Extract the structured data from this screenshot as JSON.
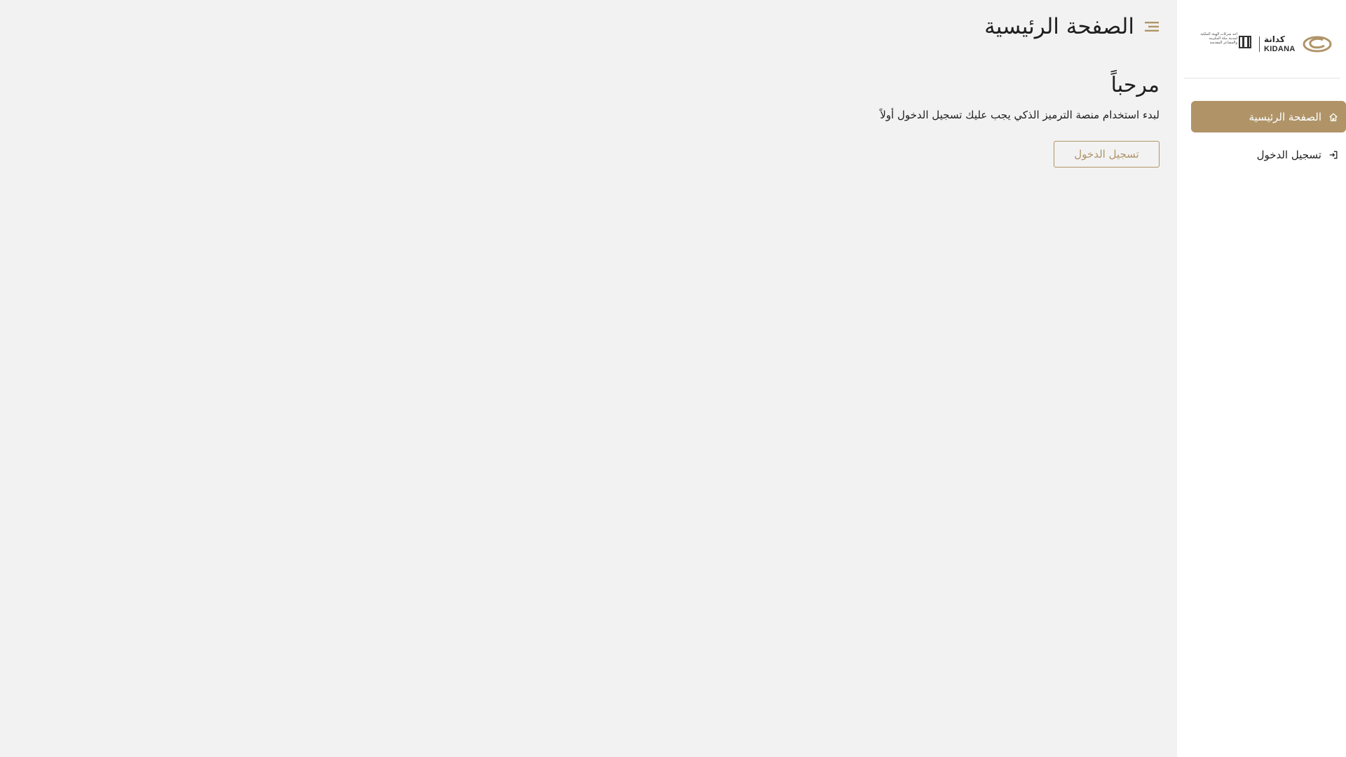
{
  "brand": {
    "accent_color": "#b09468",
    "logo": {
      "arabic_wordmark": "كدانة",
      "latin_wordmark": "KIDANA",
      "partner_text": "أحد شركات الهيئة الملكية لمدينة مكة المكرمة والمشاعر المقدسة"
    }
  },
  "sidebar": {
    "items": [
      {
        "label": "الصفحة الرئيسية",
        "icon": "home-icon",
        "active": true
      },
      {
        "label": "تسجيل الدخول",
        "icon": "login-icon",
        "active": false
      }
    ]
  },
  "header": {
    "title": "الصفحة الرئيسية",
    "menu_icon": "menu-icon"
  },
  "main": {
    "welcome_title": "مرحباً",
    "welcome_text": "لبدء استخدام منصة الترميز الذكي يجب عليك تسجيل الدخول أولاً",
    "login_button_label": "تسجيل الدخول"
  }
}
